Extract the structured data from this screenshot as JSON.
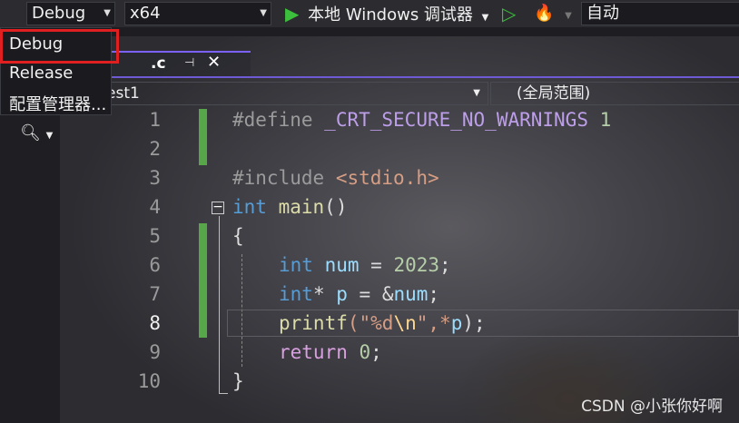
{
  "toolbar": {
    "config_value": "Debug",
    "platform_value": "x64",
    "run_label": "本地 Windows 调试器",
    "auto_label": "自动"
  },
  "dropdown": {
    "items": [
      "Debug",
      "Release",
      "配置管理器..."
    ]
  },
  "tab": {
    "name": ".c",
    "pin_glyph": "⊣",
    "close_glyph": "✕"
  },
  "navbar": {
    "project": "est1",
    "scope": "(全局范围)"
  },
  "code": {
    "line_numbers": [
      "1",
      "2",
      "3",
      "4",
      "5",
      "6",
      "7",
      "8",
      "9",
      "10"
    ],
    "current_line": "8",
    "l1_directive": "#define",
    "l1_macro": "_CRT_SECURE_NO_WARNINGS",
    "l1_value": "1",
    "l3_directive": "#include",
    "l3_header": "<stdio.h>",
    "l4_type": "int",
    "l4_fn": "main",
    "l4_parens": "()",
    "l5_brace": "{",
    "l6_type": "int",
    "l6_var": "num",
    "l6_op": " = ",
    "l6_num": "2023",
    "l6_semi": ";",
    "l7_type": "int",
    "l7_star": "*",
    "l7_var": "p",
    "l7_op": " = &",
    "l7_var2": "num",
    "l7_semi": ";",
    "l8_fn": "printf",
    "l8_open": "(\"",
    "l8_fmt": "%d",
    "l8_esc": "\\n",
    "l8_close": "\",*",
    "l8_var": "p",
    "l8_end": ");",
    "l9_kw": "return",
    "l9_num": "0",
    "l9_semi": ";",
    "l10_brace": "}"
  },
  "watermark": "CSDN @小张你好啊",
  "colors": {
    "accent": "#7b61ff",
    "change_bar": "#57a64a",
    "highlight_box": "#e02020",
    "run_icon": "#3cbf3c"
  }
}
